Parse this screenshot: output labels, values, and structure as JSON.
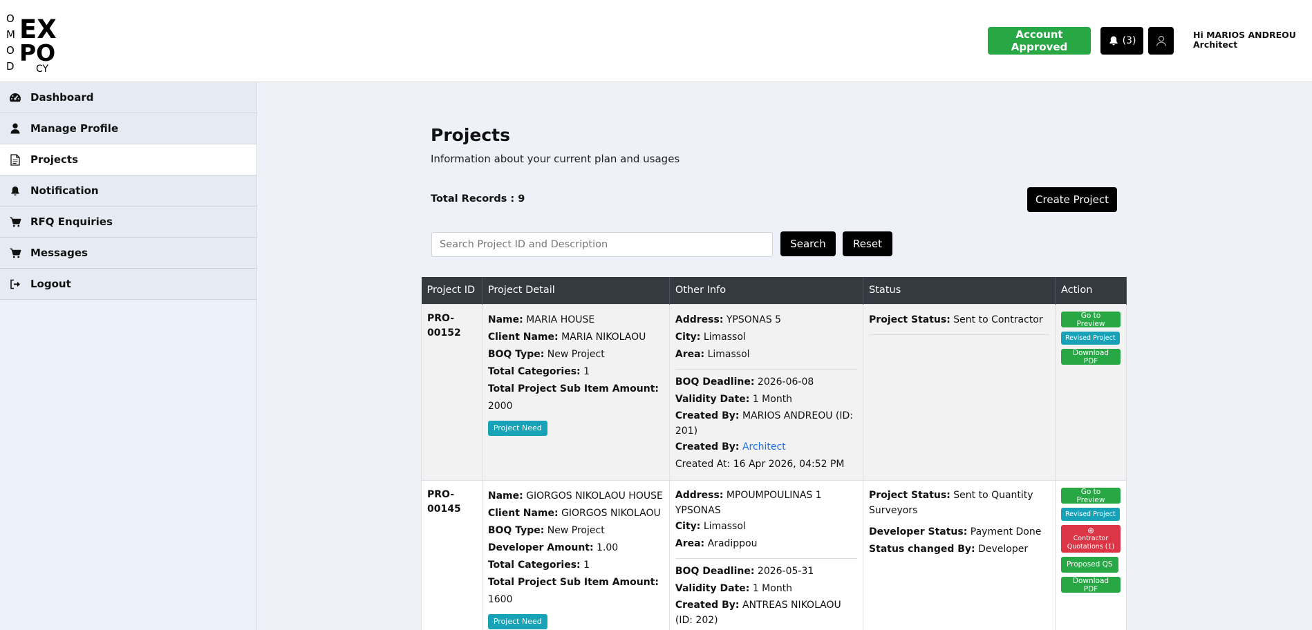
{
  "header": {
    "logo_letters": [
      "O",
      "M",
      "O",
      "D",
      "EX",
      "PO",
      "CY"
    ],
    "account_status": "Account Approved",
    "notification_count": "(3)",
    "greeting_line1": "Hi MARIOS ANDREOU",
    "greeting_line2": "Architect"
  },
  "sidebar": {
    "items": [
      {
        "label": "Dashboard",
        "icon": "dashboard-icon"
      },
      {
        "label": "Manage Profile",
        "icon": "user-icon"
      },
      {
        "label": "Projects",
        "icon": "document-icon"
      },
      {
        "label": "Notification",
        "icon": "bell-icon"
      },
      {
        "label": "RFQ Enquiries",
        "icon": "cart-icon"
      },
      {
        "label": "Messages",
        "icon": "cart-icon"
      },
      {
        "label": "Logout",
        "icon": "logout-icon"
      }
    ],
    "active_index": 2
  },
  "main": {
    "title": "Projects",
    "subtitle": "Information about your current plan and usages",
    "total_records": "Total Records : 9",
    "create_label": "Create Project",
    "search_placeholder": "Search Project ID and Description",
    "search_label": "Search",
    "reset_label": "Reset"
  },
  "table": {
    "headers": [
      "Project ID",
      "Project Detail",
      "Other Info",
      "Status",
      "Action"
    ],
    "labels": {
      "name": "Name:",
      "client": "Client Name:",
      "boq_type": "BOQ Type:",
      "developer_amount": "Developer Amount:",
      "total_categories": "Total Categories:",
      "sub_item_amount": "Total Project Sub Item Amount:",
      "address": "Address:",
      "city": "City:",
      "area": "Area:",
      "boq_deadline": "BOQ Deadline:",
      "validity": "Validity Date:",
      "created_by": "Created By:",
      "project_status": "Project Status:",
      "developer_status": "Developer Status:",
      "status_changed_by": "Status changed By:"
    },
    "rows": [
      {
        "id_line1": "PRO-",
        "id_line2": "00152",
        "name": "MARIA HOUSE",
        "client": "MARIA NIKOLAOU",
        "boq_type": "New Project",
        "total_categories": "1",
        "sub_item_amount": "2000",
        "badge": "Project Need",
        "address": "YPSONAS 5",
        "city": "Limassol",
        "area": "Limassol",
        "boq_deadline": "2026-06-08",
        "validity": "1 Month",
        "created_by": "MARIOS ANDREOU (ID: 201)",
        "created_by_role": "Architect",
        "created_at": "Created At: 16 Apr 2026, 04:52 PM",
        "project_status": "Sent to Contractor",
        "actions": [
          "Go to Preview",
          "Revised Project",
          "Download PDF"
        ]
      },
      {
        "id_line1": "PRO-",
        "id_line2": "00145",
        "name": "GIORGOS NIKOLAOU HOUSE",
        "client": "GIORGOS NIKOLAOU",
        "boq_type": "New Project",
        "developer_amount": "1.00",
        "total_categories": "1",
        "sub_item_amount": "1600",
        "badge": "Project Need",
        "address": "MPOUMPOULINAS 1 YPSONAS",
        "city": "Limassol",
        "area": "Aradippou",
        "boq_deadline": "2026-05-31",
        "validity": "1 Month",
        "created_by": "ANTREAS NIKOLAOU (ID: 202)",
        "project_status": "Sent to Quantity Surveyors",
        "developer_status": "Payment Done",
        "status_changed_by": "Developer",
        "actions": [
          "Go to Preview",
          "Revised Project",
          "Contractor Quotations (1)",
          "Proposed QS",
          "Download PDF"
        ]
      }
    ]
  }
}
